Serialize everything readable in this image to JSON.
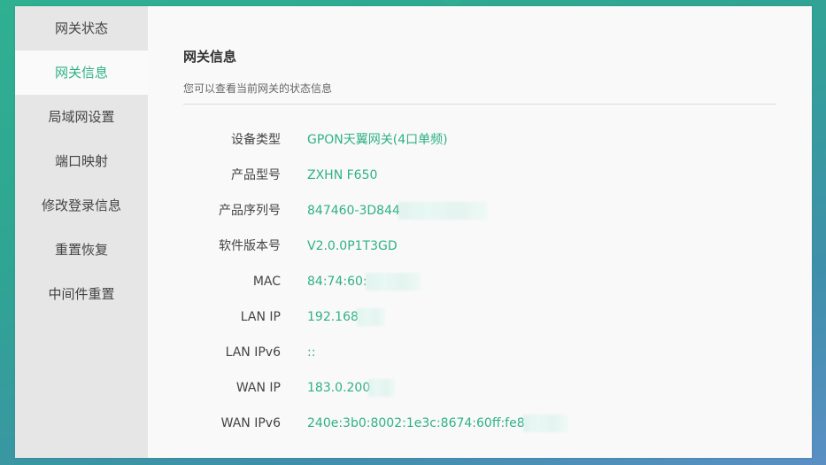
{
  "sidebar": {
    "items": [
      {
        "label": "网关状态",
        "active": false
      },
      {
        "label": "网关信息",
        "active": true
      },
      {
        "label": "局域网设置",
        "active": false
      },
      {
        "label": "端口映射",
        "active": false
      },
      {
        "label": "修改登录信息",
        "active": false
      },
      {
        "label": "重置恢复",
        "active": false
      },
      {
        "label": "中间件重置",
        "active": false
      }
    ]
  },
  "main": {
    "title": "网关信息",
    "subtitle": "您可以查看当前网关的状态信息",
    "rows": [
      {
        "label": "设备类型",
        "value": "GPON天翼网关(4口单频)"
      },
      {
        "label": "产品型号",
        "value": "ZXHN F650"
      },
      {
        "label": "产品序列号",
        "value": "847460-3D844"
      },
      {
        "label": "软件版本号",
        "value": "V2.0.0P1T3GD"
      },
      {
        "label": "MAC",
        "value": "84:74:60:"
      },
      {
        "label": "LAN IP",
        "value": "192.168"
      },
      {
        "label": "LAN IPv6",
        "value": "::"
      },
      {
        "label": "WAN IP",
        "value": "183.0.200"
      },
      {
        "label": "WAN IPv6",
        "value": "240e:3b0:8002:1e3c:8674:60ff:fe8"
      }
    ]
  },
  "colors": {
    "accent": "#2fb188",
    "sidebar_bg": "#e6e6e6",
    "panel_bg": "#f9f9f9"
  }
}
